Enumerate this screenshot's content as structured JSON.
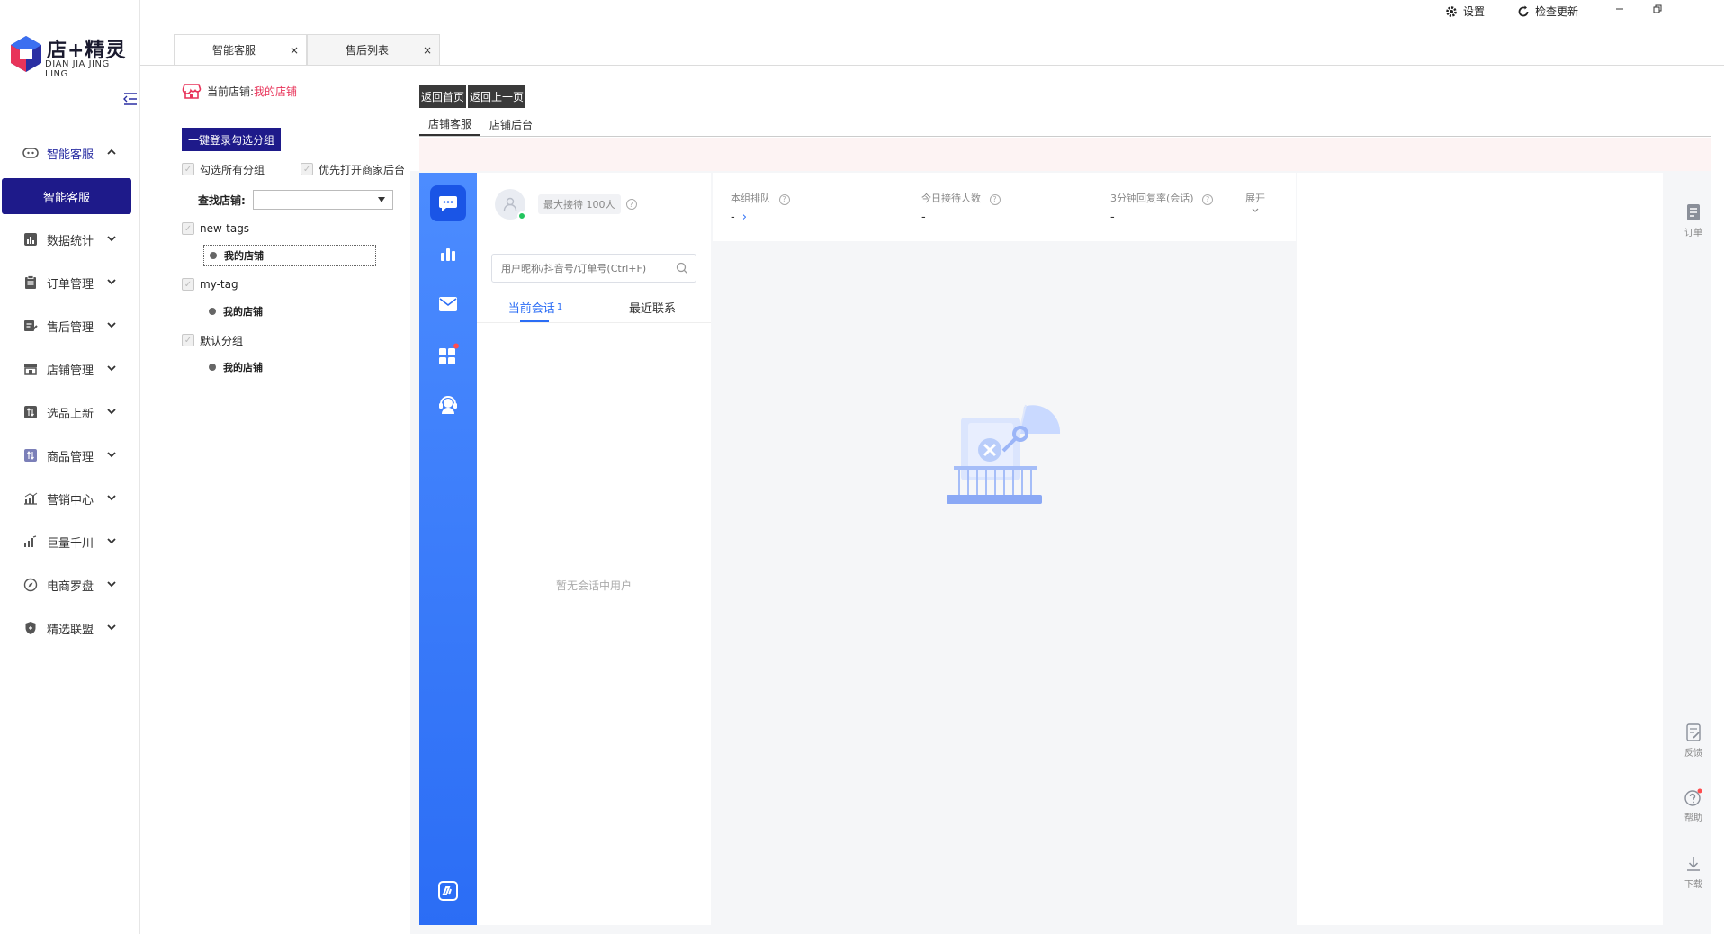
{
  "brand": {
    "name": "店+精灵",
    "sub": "DIAN JIA JING LING"
  },
  "titlebar": {
    "settings": "设置",
    "check_update": "检查更新"
  },
  "tabs": [
    {
      "label": "智能客服"
    },
    {
      "label": "售后列表"
    }
  ],
  "tab_close": "×",
  "sidebar": {
    "items": [
      {
        "label": "智能客服",
        "icon": "chat-bot-icon"
      },
      {
        "label": "数据统计",
        "icon": "bar-chart-icon"
      },
      {
        "label": "订单管理",
        "icon": "clipboard-icon"
      },
      {
        "label": "售后管理",
        "icon": "edit-doc-icon"
      },
      {
        "label": "店铺管理",
        "icon": "store-icon"
      },
      {
        "label": "选品上新",
        "icon": "sort-box-icon"
      },
      {
        "label": "商品管理",
        "icon": "sort-box-icon"
      },
      {
        "label": "营销中心",
        "icon": "marketing-chart-icon"
      },
      {
        "label": "巨量千川",
        "icon": "signal-icon"
      },
      {
        "label": "电商罗盘",
        "icon": "compass-icon"
      },
      {
        "label": "精选联盟",
        "icon": "shield-icon"
      }
    ],
    "sub_active": "智能客服"
  },
  "store_panel": {
    "current_label": "当前店铺:",
    "current_value": "我的店铺",
    "login_btn": "一键登录勾选分组",
    "select_all": "勾选所有分组",
    "prefer_open": "优先打开商家后台",
    "find_label": "查找店铺:",
    "groups": [
      {
        "name": "new-tags",
        "store": "我的店铺"
      },
      {
        "name": "my-tag",
        "store": "我的店铺"
      },
      {
        "name": "默认分组",
        "store": "我的店铺"
      }
    ]
  },
  "nav_buttons": {
    "home": "返回首页",
    "back": "返回上一页"
  },
  "subtabs": [
    {
      "label": "店铺客服"
    },
    {
      "label": "店铺后台"
    }
  ],
  "chat": {
    "max_reception": "最大接待 100人",
    "search_placeholder": "用户昵称/抖音号/订单号(Ctrl+F)",
    "tab_current": "当前会话",
    "tab_current_count": "1",
    "tab_recent": "最近联系",
    "empty_text": "暂无会话中用户",
    "stats": [
      {
        "label": "本组排队",
        "value": "-"
      },
      {
        "label": "今日接待人数",
        "value": "-"
      },
      {
        "label": "3分钟回复率(会话)",
        "value": "-"
      }
    ],
    "expand": "展开"
  },
  "right_rail": [
    {
      "label": "订单",
      "icon": "order-doc-icon"
    },
    {
      "label": "反馈",
      "icon": "feedback-icon"
    },
    {
      "label": "帮助",
      "icon": "help-icon"
    },
    {
      "label": "下载",
      "icon": "download-icon"
    }
  ],
  "colors": {
    "accent": "#1e1a8a",
    "chat_blue": "#2b6df5",
    "store_red": "#e8345a"
  }
}
